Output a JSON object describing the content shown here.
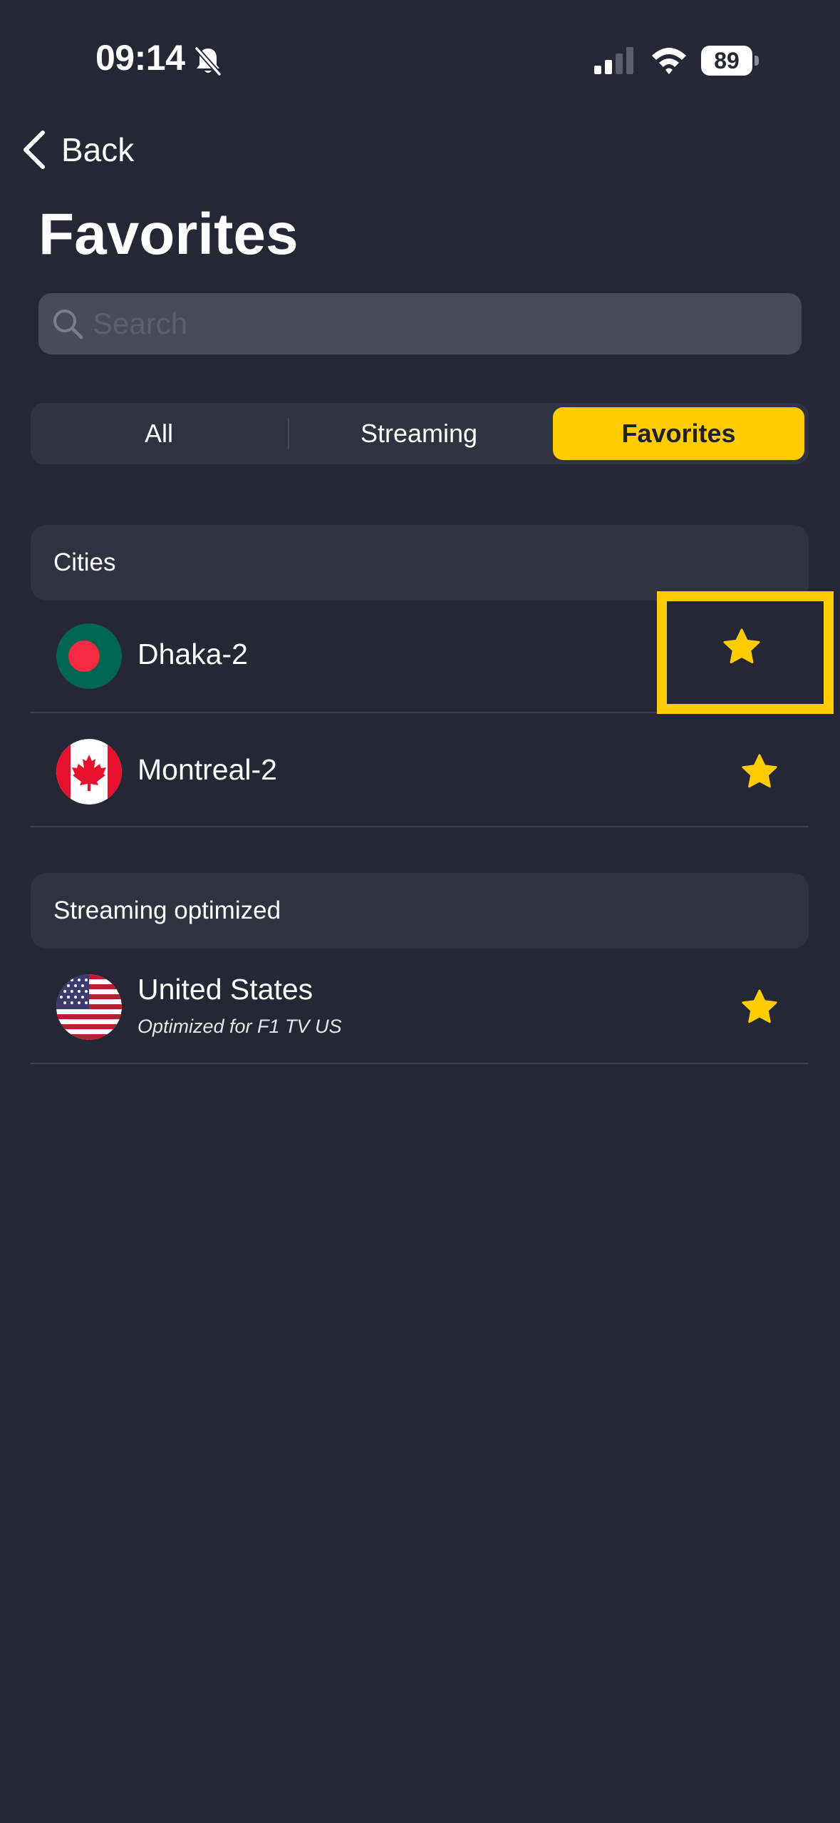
{
  "status_bar": {
    "time": "09:14",
    "battery": "89"
  },
  "nav": {
    "back_label": "Back"
  },
  "page": {
    "title": "Favorites"
  },
  "search": {
    "placeholder": "Search",
    "value": ""
  },
  "tabs": [
    {
      "label": "All",
      "selected": false
    },
    {
      "label": "Streaming",
      "selected": false
    },
    {
      "label": "Favorites",
      "selected": true
    }
  ],
  "sections": [
    {
      "header": "Cities",
      "items": [
        {
          "title": "Dhaka-2",
          "flag": "bangladesh-flag",
          "favorite": true
        },
        {
          "title": "Montreal-2",
          "flag": "canada-flag",
          "favorite": true
        }
      ]
    },
    {
      "header": "Streaming optimized",
      "items": [
        {
          "title": "United States",
          "subtitle": "Optimized for F1 TV US",
          "flag": "usa-flag",
          "favorite": true
        }
      ]
    }
  ],
  "colors": {
    "background": "#262734",
    "accent": "#ffcc00",
    "surface": "#31323f",
    "search_bg": "#4a4a58"
  }
}
